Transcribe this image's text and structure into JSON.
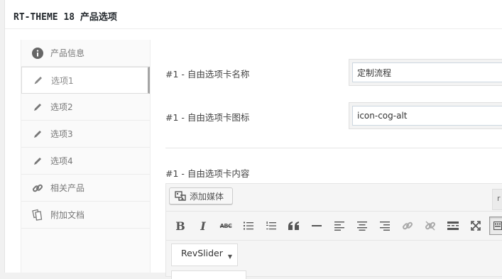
{
  "metabox": {
    "title": "RT-THEME 18 产品选项"
  },
  "tabs": [
    {
      "label": "产品信息",
      "icon": "info-icon"
    },
    {
      "label": "选项1",
      "icon": "pencil-icon"
    },
    {
      "label": "选项2",
      "icon": "pencil-icon"
    },
    {
      "label": "选项3",
      "icon": "pencil-icon"
    },
    {
      "label": "选项4",
      "icon": "pencil-icon"
    },
    {
      "label": "相关产品",
      "icon": "link-icon"
    },
    {
      "label": "附加文档",
      "icon": "documents-icon"
    }
  ],
  "active_tab": "选项1",
  "fields": {
    "tab_name": {
      "label": "#1 - 自由选项卡名称",
      "value": "定制流程"
    },
    "tab_icon": {
      "label": "#1 - 自由选项卡图标",
      "value": "icon-cog-alt"
    },
    "tab_content": {
      "label": "#1 - 自由选项卡内容"
    }
  },
  "editor": {
    "add_media_label": "添加媒体",
    "text_tab_label": "r",
    "toolbar": {
      "bold": "B",
      "italic": "I",
      "strikethrough": "ABC"
    },
    "shortcode_select": "RevSlider",
    "caret": "▼"
  },
  "colors": {
    "active_tab_border": "#a5a5a5",
    "input_border": "#ccd7e0",
    "toolbar_bg": "#f5f5f5"
  }
}
